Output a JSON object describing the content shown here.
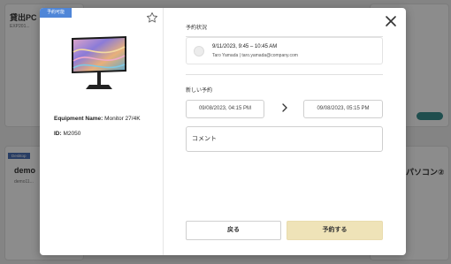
{
  "background": {
    "card1": {
      "title": "貸出PC",
      "subtitle": "EXP201..."
    },
    "card2": {
      "tag": "Desktop",
      "title": "demo ",
      "subtitle": "demo11..."
    },
    "card3": {
      "title": "パソコン②"
    }
  },
  "modal": {
    "badge": "予約可能",
    "equipment_name_label": "Equipment Name:",
    "equipment_name_value": "Monitor 27/4K",
    "id_label": "ID:",
    "id_value": "M2050",
    "reservation_status_label": "予約状況",
    "existing_reservation": {
      "time": "9/11/2023, 9:45 – 10:45 AM",
      "user": "Taro Yamada | taro.yamada@company.com"
    },
    "new_reservation_label": "新しい予約",
    "start_datetime": "09/08/2023, 04:15 PM",
    "end_datetime": "09/08/2023, 05:15 PM",
    "comment_placeholder": "コメント",
    "back_button": "戻る",
    "reserve_button": "予約する"
  },
  "icons": {
    "star": "star-outline-icon",
    "close": "close-icon",
    "arrow": "chevron-right-icon",
    "avatar": "user-avatar-icon"
  },
  "colors": {
    "badge": "#4f86d8",
    "reserve_button": "#efe3b8",
    "overlay": "rgba(0,0,0,0.45)"
  }
}
